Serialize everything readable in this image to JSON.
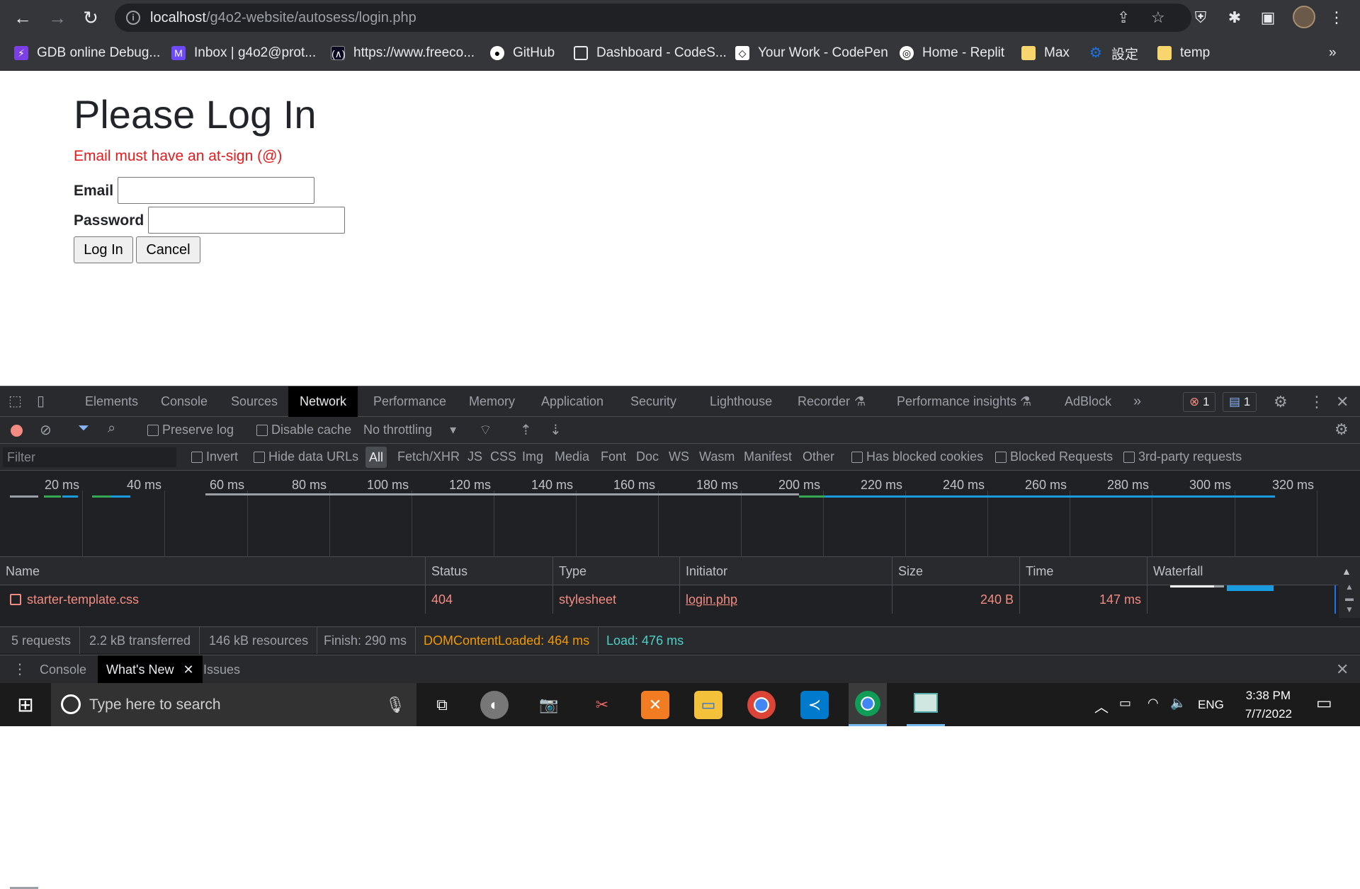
{
  "browser": {
    "url_host": "localhost",
    "url_path": "/g4o2-website/autosess/login.php",
    "bookmarks": [
      {
        "label": "GDB online Debug...",
        "icon": "gdb-icon",
        "color": "#7b3fe4"
      },
      {
        "label": "Inbox | g4o2@prot...",
        "icon": "protonmail-icon",
        "color": "#6d4aff"
      },
      {
        "label": "https://www.freeco...",
        "icon": "freecodecamp-icon",
        "color": "#0a0a23"
      },
      {
        "label": "GitHub",
        "icon": "github-icon",
        "color": "#ffffff"
      },
      {
        "label": "Dashboard - CodeS...",
        "icon": "codesignal-icon",
        "color": "#e8eaed"
      },
      {
        "label": "Your Work - CodePen",
        "icon": "codepen-icon",
        "color": "#ffffff"
      },
      {
        "label": "Home - Replit",
        "icon": "replit-icon",
        "color": "#ffffff"
      },
      {
        "label": "Max",
        "icon": "folder-icon",
        "color": "#f9d56e"
      },
      {
        "label": "設定",
        "icon": "gear-icon",
        "color": "#1a73e8"
      },
      {
        "label": "temp",
        "icon": "folder-icon",
        "color": "#f9d56e"
      }
    ]
  },
  "page": {
    "title": "Please Log In",
    "error": "Email must have an at-sign (@)",
    "email_label": "Email",
    "email_value": "",
    "password_label": "Password",
    "password_value": "",
    "login_button": "Log In",
    "cancel_button": "Cancel"
  },
  "devtools": {
    "tabs": [
      "Elements",
      "Console",
      "Sources",
      "Network",
      "Performance",
      "Memory",
      "Application",
      "Security",
      "Lighthouse",
      "Recorder",
      "Performance insights",
      "AdBlock"
    ],
    "active_tab": "Network",
    "error_count": "1",
    "message_count": "1",
    "toolbar": {
      "preserve_log": "Preserve log",
      "disable_cache": "Disable cache",
      "throttling": "No throttling"
    },
    "filter": {
      "placeholder": "Filter",
      "invert": "Invert",
      "hide_data_urls": "Hide data URLs",
      "types": [
        "All",
        "Fetch/XHR",
        "JS",
        "CSS",
        "Img",
        "Media",
        "Font",
        "Doc",
        "WS",
        "Wasm",
        "Manifest",
        "Other"
      ],
      "has_blocked_cookies": "Has blocked cookies",
      "blocked_requests": "Blocked Requests",
      "third_party": "3rd-party requests"
    },
    "timeline_ticks": [
      "20 ms",
      "40 ms",
      "60 ms",
      "80 ms",
      "100 ms",
      "120 ms",
      "140 ms",
      "160 ms",
      "180 ms",
      "200 ms",
      "220 ms",
      "240 ms",
      "260 ms",
      "280 ms",
      "300 ms",
      "320 ms"
    ],
    "columns": [
      "Name",
      "Status",
      "Type",
      "Initiator",
      "Size",
      "Time",
      "Waterfall"
    ],
    "rows": [
      {
        "name": "starter-template.css",
        "status": "404",
        "type": "stylesheet",
        "initiator": "login.php",
        "size": "240 B",
        "time": "147 ms"
      }
    ],
    "summary": {
      "requests": "5 requests",
      "transferred": "2.2 kB transferred",
      "resources": "146 kB resources",
      "finish": "Finish: 290 ms",
      "dom_content_loaded": "DOMContentLoaded: 464 ms",
      "load": "Load: 476 ms"
    },
    "drawer_tabs": [
      "Console",
      "What's New",
      "Issues"
    ],
    "drawer_active": "What's New"
  },
  "taskbar": {
    "search_placeholder": "Type here to search",
    "language": "ENG",
    "time": "3:38 PM",
    "date": "7/7/2022"
  }
}
